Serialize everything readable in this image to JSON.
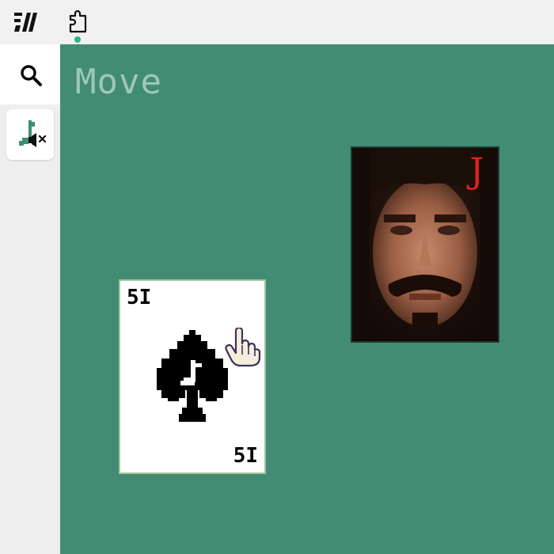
{
  "table": {
    "mode_label": "Move",
    "felt_color": "#428c74"
  },
  "cards": [
    {
      "rank": "A",
      "suit": "spade",
      "rank_label": "5I",
      "face_up": true
    },
    {
      "rank": "J",
      "rank_label": "J",
      "face_up": true,
      "style": "photo-portrait"
    }
  ],
  "icons": {
    "logo": "logo-icon",
    "extension": "puzzle-piece-icon",
    "search": "search-icon",
    "sound": "muted-sound-icon",
    "cursor": "hand-pointer-icon"
  },
  "colors": {
    "accent": "#2fb18a",
    "jack_rank": "#e0231c"
  }
}
